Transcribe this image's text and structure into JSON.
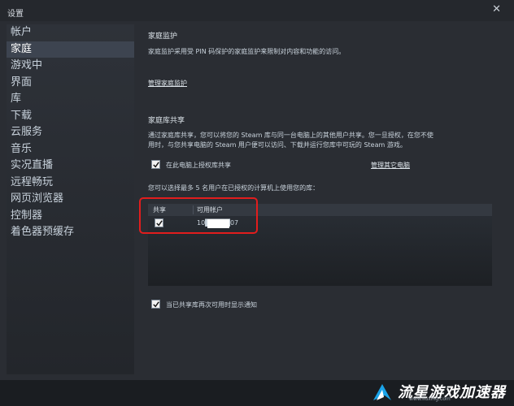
{
  "window": {
    "title": "设置",
    "close_glyph": "✕"
  },
  "sidebar": {
    "items": [
      {
        "label": "帐户"
      },
      {
        "label": "家庭"
      },
      {
        "label": "游戏中"
      },
      {
        "label": "界面"
      },
      {
        "label": "库"
      },
      {
        "label": "下载"
      },
      {
        "label": "云服务"
      },
      {
        "label": "音乐"
      },
      {
        "label": "实况直播"
      },
      {
        "label": "远程畅玩"
      },
      {
        "label": "网页浏览器"
      },
      {
        "label": "控制器"
      },
      {
        "label": "着色器预缓存"
      }
    ],
    "active_index": 1
  },
  "family_view": {
    "title": "家庭监护",
    "description": "家庭监护采用受 PIN 码保护的家庭监护来限制对内容和功能的访问。",
    "manage_link": "管理家庭监护"
  },
  "library_sharing": {
    "title": "家庭库共享",
    "description_line1": "通过家庭库共享，您可以将您的 Steam 库与同一台电脑上的其他用户共享。您一旦授权，在您不使",
    "description_line2": "用时，与您共享电脑的 Steam 用户便可以访问、下载并运行您库中可玩的 Steam 游戏。",
    "authorize_checkbox_label": "在此电脑上授权库共享",
    "authorize_checked": true,
    "manage_other_link": "管理其它电脑",
    "limit_text": "您可以选择最多 5 名用户在已授权的计算机上使用您的库：",
    "table": {
      "columns": [
        "共享",
        "可用帐户"
      ],
      "rows": [
        {
          "shared": true,
          "account": "10█████07"
        }
      ]
    },
    "notify_checkbox_label": "当已共享库再次可用时显示通知",
    "notify_checked": true
  },
  "watermark": {
    "main": "流星游戏加速器",
    "sub": "www.liuxing.com",
    "accent": "#1aa3e8"
  },
  "colors": {
    "background": "#2a2d33",
    "active_item": "#3d4450",
    "highlight_border": "#e21d1d"
  }
}
